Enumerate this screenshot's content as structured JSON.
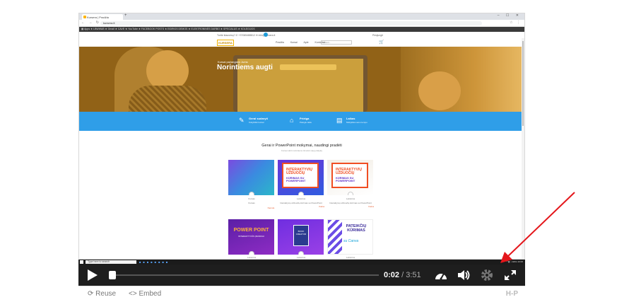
{
  "browser": {
    "tab_title": "Kursera | Pradžia",
    "new_tab": "+",
    "window_controls": "– ☐ ✕",
    "nav_buttons": "← → ↻ ⌂",
    "url": "kursera.lt",
    "extensions": "☆ ⋮",
    "bookmarks": "▦ Apps  ★ LBWWAB  ★ Gmail  ★ CAVE  ★ YouTube  ★ FACEBOOK POSTS  ★ EIDRIOS DEMOS  ★ ELEKTRONINĖS DARBO  ★ SPECIALUS  ★ KOLEGIJOS"
  },
  "site": {
    "contacts": "Turite klausimų?  ✆ +37065488812  ✉ info@kursera.lt",
    "login": "Prisijungti",
    "logo": "KURSERA",
    "menu": "Pradžia  Kursai  Apie  Kontaktai",
    "search_placeholder": "Ieškoti...",
    "hero_small": "Kursai pažangiam Jums",
    "hero_title": "Norintiems augti",
    "features": [
      {
        "title": "Gerai sudaryti",
        "sub": "Kokybiški kursai",
        "icon": "✎"
      },
      {
        "title": "Prieiga",
        "sub": "Patogiu laiku",
        "icon": "⌂"
      },
      {
        "title": "Laikas",
        "sub": "Mokykitės savu tempu",
        "icon": "▤"
      }
    ],
    "courses_heading": "Gerai ir PowerPoint mokymai, naudingi pradėti",
    "courses_sub": "Kursai skirti norintiems išmokti naujų dalykų",
    "cards": [
      {
        "meta_top": "Kursas",
        "meta_title": "Kursas",
        "meta_price": "Nemok."
      },
      {
        "meta_top": "Lektorius",
        "meta_title": "Interaktyvių užduočių kūrimas su PowerPoint",
        "meta_price": "Kaina"
      },
      {
        "meta_top": "Lektorius",
        "meta_title": "Interaktyvių užduočių kūrimas su PowerPoint",
        "meta_price": "Kaina"
      },
      {
        "meta_top": "Lektorius"
      },
      {
        "meta_top": "Lektorius"
      },
      {
        "meta_top": "Lektorius"
      }
    ],
    "card_art": {
      "ppt_line1": "INTERAKTYVIŲ UŽDUOČIŲ",
      "ppt_line2": "KŪRIMAS SU POWERPOINT",
      "pp_title": "POWER POINT",
      "pp_sub": "INTERAKTYVŪS ĮRANKIAI",
      "book_text": "BOOK CREATOR",
      "canva_title": "PATEIKČIŲ KŪRIMAS",
      "canva_sub": "su Canva"
    }
  },
  "taskbar": {
    "search_placeholder": "Type here to search",
    "tray": "^ ◧ ♪ ENG  16:00"
  },
  "player": {
    "current_time": "0:02",
    "separator": "/",
    "duration": "3:51",
    "progress": 0.009
  },
  "footer": {
    "reuse_label": "Reuse",
    "embed_label": "Embed",
    "h5p_logo": "H-P"
  },
  "colors": {
    "band_blue": "#2f9ee8",
    "accent_orange": "#f2b400",
    "arrow_red": "#e4161b"
  }
}
